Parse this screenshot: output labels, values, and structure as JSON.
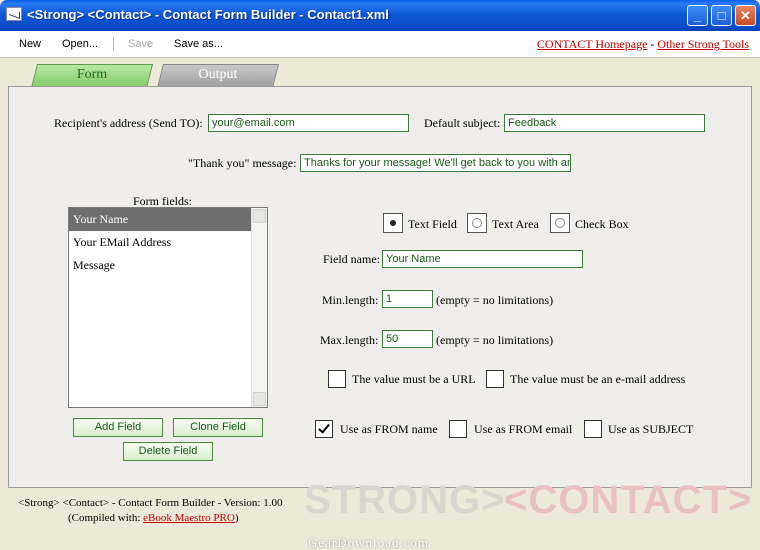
{
  "window": {
    "title": "<Strong> <Contact> - Contact Form Builder - Contact1.xml",
    "min_glyph": "_",
    "max_glyph": "□",
    "close_glyph": "✕"
  },
  "toolbar": {
    "new": "New",
    "open": "Open...",
    "save": "Save",
    "save_as": "Save as...",
    "link_homepage": "CONTACT Homepage",
    "link_sep": " - ",
    "link_tools": "Other Strong Tools"
  },
  "tabs": {
    "form": "Form",
    "output": "Output"
  },
  "form": {
    "recipient_label": "Recipient's address (Send TO):",
    "recipient_value": "your@email.com",
    "subject_label": "Default subject:",
    "subject_value": "Feedback",
    "thanks_label": "\"Thank you\" message:",
    "thanks_value": "Thanks for your message! We'll get back to you with an",
    "fields_label": "Form fields:",
    "fields": [
      "Your Name",
      "Your EMail Address",
      "Message"
    ],
    "add_field": "Add Field",
    "clone_field": "Clone Field",
    "delete_field": "Delete Field",
    "type_text_field": "Text Field",
    "type_text_area": "Text Area",
    "type_check_box": "Check Box",
    "field_name_label": "Field name:",
    "field_name_value": "Your Name",
    "min_length_label": "Min.length:",
    "min_length_value": "1",
    "max_length_label": "Max.length:",
    "max_length_value": "50",
    "empty_hint": "(empty = no limitations)",
    "must_url": "The value must be a URL",
    "must_email": "The value must be an e-mail address",
    "use_from_name": "Use as FROM name",
    "use_from_email": "Use as FROM email",
    "use_subject": "Use as SUBJECT"
  },
  "footer": {
    "version_line": "<Strong> <Contact> - Contact Form Builder - Version: 1.00",
    "compiled_prefix": "(Compiled with: ",
    "compiled_link": "eBook Maestro PRO",
    "compiled_suffix": ")",
    "wm_strong": "STRONG>",
    "wm_contact": "<CONTACT>",
    "wm_site": "GearDownload.com"
  }
}
